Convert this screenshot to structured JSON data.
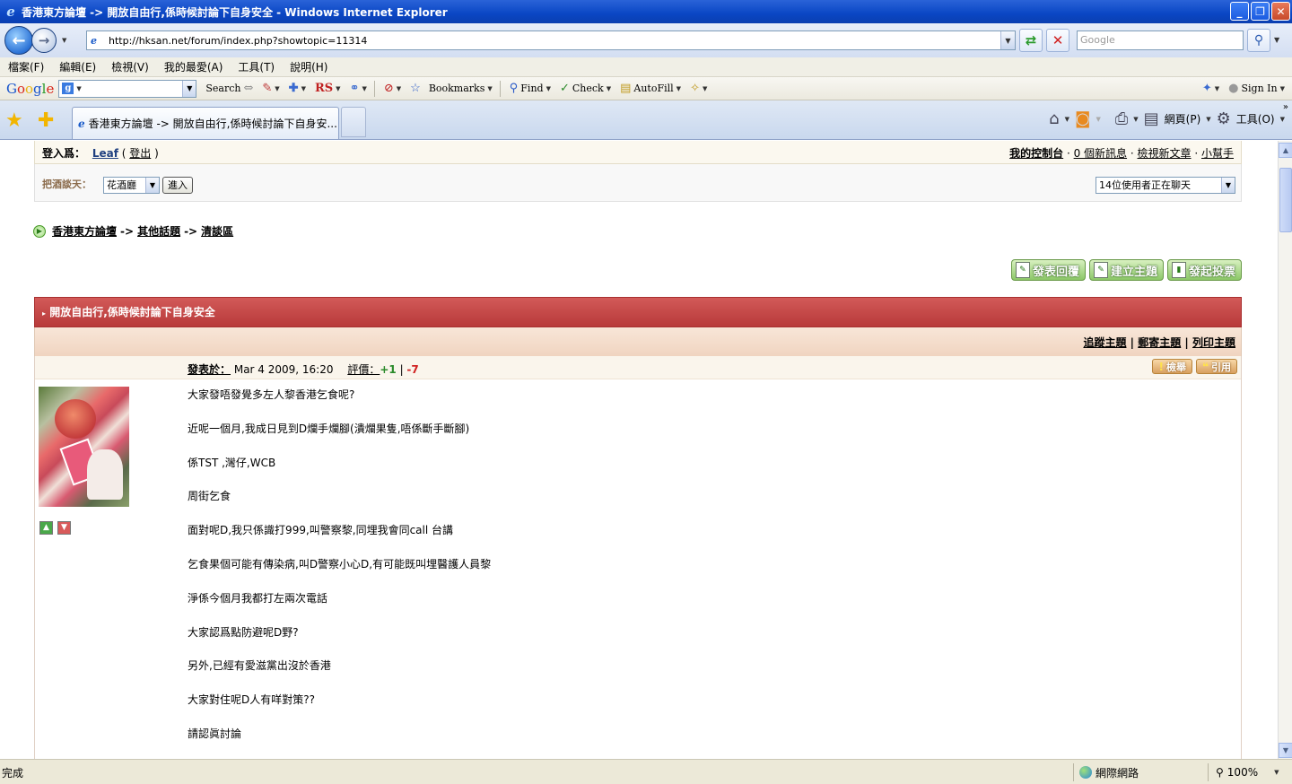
{
  "window": {
    "title": "香港東方論壇 -> 開放自由行,係時候討論下自身安全 - Windows Internet Explorer",
    "buttons": [
      "_",
      "❐",
      "✕"
    ]
  },
  "address": {
    "url": "http://hksan.net/forum/index.php?showtopic=11314",
    "search_placeholder": "Google"
  },
  "menu": [
    "檔案(F)",
    "編輯(E)",
    "檢視(V)",
    "我的最愛(A)",
    "工具(T)",
    "說明(H)"
  ],
  "google_toolbar": {
    "logo": [
      "G",
      "o",
      "o",
      "g",
      "l",
      "e"
    ],
    "search": "Search",
    "rs": "RS",
    "bookmarks": "Bookmarks",
    "find": "Find",
    "check": "Check",
    "autofill": "AutoFill",
    "sign_in": "Sign In"
  },
  "tab": {
    "title": "香港東方論壇 -> 開放自由行,係時候討論下自身安..."
  },
  "command_bar": {
    "page": "網頁(P)",
    "tools": "工具(O)"
  },
  "status": {
    "text": "完成",
    "zone": "網際網路",
    "zoom": "100%"
  },
  "forum": {
    "login_label": "登入爲：",
    "username": "Leaf",
    "logout": "登出",
    "control_panel": "我的控制台",
    "messages": "0 個新訊息",
    "new_posts": "檢視新文章",
    "helper": "小幫手",
    "chat_label": "把酒談天：",
    "chat_room": "花酒廳",
    "enter": "進入",
    "online": "14位使用者正在聊天",
    "breadcrumbs": [
      "香港東方論壇",
      "其他話題",
      "清談區"
    ],
    "actions": [
      "發表回覆",
      "建立主題",
      "發起投票"
    ],
    "topic_title": "開放自由行,係時候討論下自身安全",
    "topic_tools": [
      "追蹤主題",
      "郵寄主題",
      "列印主題"
    ],
    "post": {
      "posted_label": "發表於：",
      "date": "Mar 4 2009, 16:20",
      "rating_label": "評價：",
      "plus": "+1",
      "minus": "-7",
      "report": "檢舉",
      "quote": "引用",
      "lines": [
        "大家發唔發覺多左人黎香港乞食呢?",
        "近呢一個月,我成日見到D爛手爛腳(潰爛果隻,唔係斷手斷腳)",
        "係TST ,灣仔,WCB",
        "周街乞食",
        "面對呢D,我只係識打999,叫警察黎,同埋我會同call 台講",
        "乞食果個可能有傳染病,叫D警察小心D,有可能既叫埋醫護人員黎",
        "淨係今個月我都打左兩次電話",
        "大家認爲點防避呢D野?",
        "另外,已經有愛滋黨出沒於香港",
        "大家對住呢D人有咩對策??",
        "請認眞討論"
      ]
    }
  }
}
